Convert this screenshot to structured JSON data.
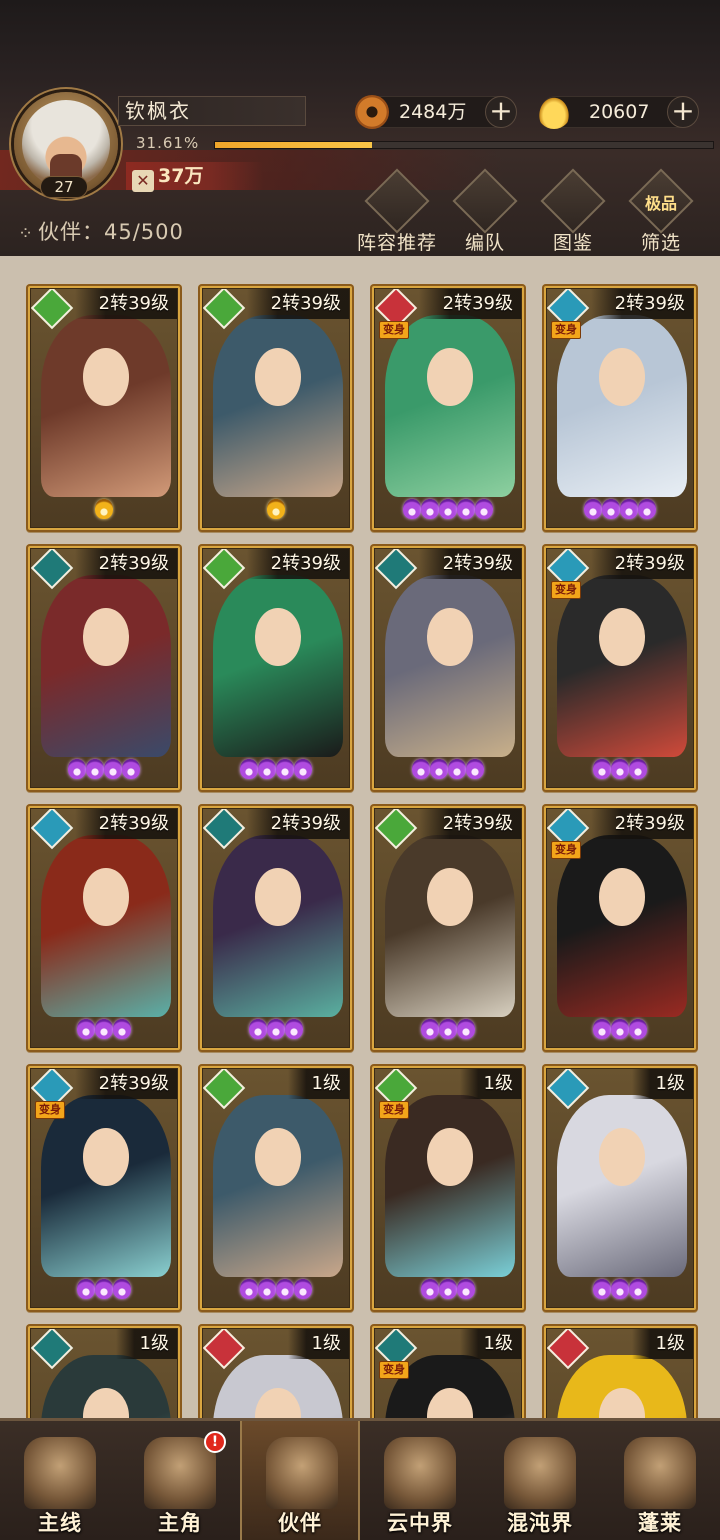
{
  "player": {
    "name": "钦枫衣",
    "level": "27",
    "exp_text": "31.61%",
    "exp_fraction": 0.3161,
    "power": "37万"
  },
  "currency": {
    "coins": "2484万",
    "ingots": "20607",
    "add_symbol": "+"
  },
  "partners": {
    "label": "伙伴：45/500"
  },
  "tools": [
    {
      "label": "阵容推荐",
      "icon": "team-recommend-icon"
    },
    {
      "label": "编队",
      "icon": "formation-flag-icon"
    },
    {
      "label": "图鉴",
      "icon": "scroll-icon"
    },
    {
      "label": "筛选",
      "icon": "filter-icon",
      "badge": "极品"
    }
  ],
  "transform_badge": "变身",
  "cards": [
    {
      "level": "2转39级",
      "element": "wood",
      "flames": 1,
      "flame_color": "gold",
      "transform": false,
      "palette": [
        "#6e3a2a",
        "#d29a78"
      ]
    },
    {
      "level": "2转39级",
      "element": "wood",
      "flames": 1,
      "flame_color": "gold",
      "transform": false,
      "palette": [
        "#3d5a6a",
        "#c9a78a"
      ]
    },
    {
      "level": "2转39级",
      "element": "fire",
      "flames": 5,
      "flame_color": "purple",
      "transform": true,
      "palette": [
        "#3a9a6a",
        "#8ed0a0"
      ]
    },
    {
      "level": "2转39级",
      "element": "water",
      "flames": 4,
      "flame_color": "purple",
      "transform": true,
      "palette": [
        "#b8c6d6",
        "#e8eef4"
      ]
    },
    {
      "level": "2转39级",
      "element": "dark",
      "flames": 4,
      "flame_color": "purple",
      "transform": false,
      "palette": [
        "#7a2a2a",
        "#3a4a6a"
      ]
    },
    {
      "level": "2转39级",
      "element": "wood",
      "flames": 4,
      "flame_color": "purple",
      "transform": false,
      "palette": [
        "#2a8a5a",
        "#1a1a1a"
      ]
    },
    {
      "level": "2转39级",
      "element": "dark",
      "flames": 4,
      "flame_color": "purple",
      "transform": false,
      "palette": [
        "#6a6a7a",
        "#c9b08a"
      ]
    },
    {
      "level": "2转39级",
      "element": "water",
      "flames": 3,
      "flame_color": "purple",
      "transform": true,
      "palette": [
        "#2a2a2a",
        "#d04a3a"
      ]
    },
    {
      "level": "2转39级",
      "element": "water",
      "flames": 3,
      "flame_color": "purple",
      "transform": false,
      "palette": [
        "#8a2a1a",
        "#5ab0a8"
      ]
    },
    {
      "level": "2转39级",
      "element": "dark",
      "flames": 3,
      "flame_color": "purple",
      "transform": false,
      "palette": [
        "#3a2a4a",
        "#5ab0a0"
      ]
    },
    {
      "level": "2转39级",
      "element": "wood",
      "flames": 3,
      "flame_color": "purple",
      "transform": false,
      "palette": [
        "#4a3a2a",
        "#d8d0c0"
      ]
    },
    {
      "level": "2转39级",
      "element": "water",
      "flames": 3,
      "flame_color": "purple",
      "transform": true,
      "palette": [
        "#1a1a1a",
        "#9a2a22"
      ]
    },
    {
      "level": "2转39级",
      "element": "water",
      "flames": 3,
      "flame_color": "purple",
      "transform": true,
      "palette": [
        "#1a2a3a",
        "#8ad0d0"
      ]
    },
    {
      "level": "1级",
      "element": "wood",
      "flames": 4,
      "flame_color": "purple",
      "transform": false,
      "palette": [
        "#3d5a6a",
        "#c9a78a"
      ]
    },
    {
      "level": "1级",
      "element": "wood",
      "flames": 3,
      "flame_color": "purple",
      "transform": true,
      "palette": [
        "#3a2a22",
        "#7ad0d8"
      ]
    },
    {
      "level": "1级",
      "element": "water",
      "flames": 3,
      "flame_color": "purple",
      "transform": false,
      "palette": [
        "#d8d8e0",
        "#6a6a7a"
      ]
    },
    {
      "level": "1级",
      "element": "dark",
      "flames": 0,
      "flame_color": "purple",
      "transform": false,
      "palette": [
        "#2a3a3a",
        "#6ab0a0"
      ]
    },
    {
      "level": "1级",
      "element": "fire",
      "flames": 0,
      "flame_color": "purple",
      "transform": false,
      "palette": [
        "#c8c8d0",
        "#8a7aa0"
      ]
    },
    {
      "level": "1级",
      "element": "dark",
      "flames": 0,
      "flame_color": "purple",
      "transform": true,
      "palette": [
        "#1a1a1a",
        "#d8c8b8"
      ]
    },
    {
      "level": "1级",
      "element": "fire",
      "flames": 0,
      "flame_color": "purple",
      "transform": false,
      "palette": [
        "#e8b81a",
        "#c83a2a"
      ]
    }
  ],
  "element_colors": {
    "wood": "#4aa83a",
    "fire": "#c8323a",
    "water": "#2a9ab8",
    "dark": "#1f7a78"
  },
  "nav": [
    {
      "label": "主线",
      "icon": "crossed-swords-icon",
      "active": false,
      "alert": ""
    },
    {
      "label": "主角",
      "icon": "hero-icon",
      "active": false,
      "alert": "!"
    },
    {
      "label": "伙伴",
      "icon": "partner-helmet-icon",
      "active": true,
      "alert": ""
    },
    {
      "label": "云中界",
      "icon": "cloud-palace-icon",
      "active": false,
      "alert": ""
    },
    {
      "label": "混沌界",
      "icon": "chaos-pagoda-icon",
      "active": false,
      "alert": ""
    },
    {
      "label": "蓬莱",
      "icon": "penglai-icon",
      "active": false,
      "alert": ""
    }
  ]
}
